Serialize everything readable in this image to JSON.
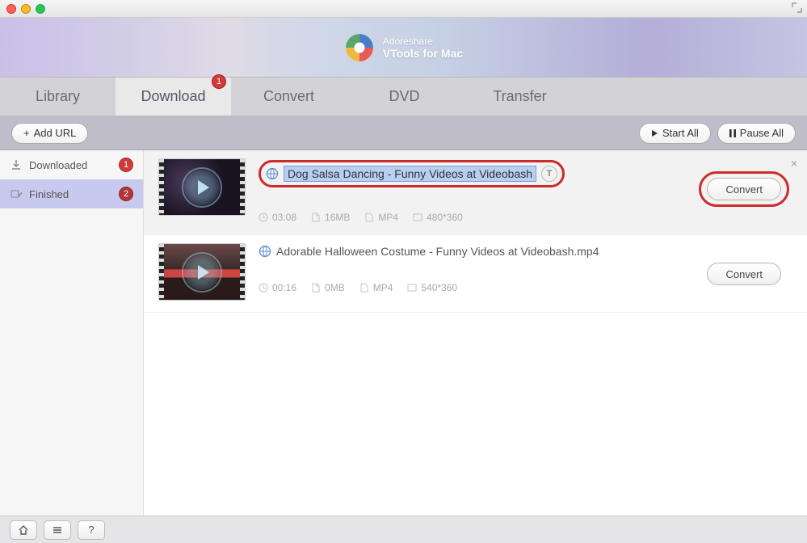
{
  "brand": "Adoreshare",
  "product": "VTools for Mac",
  "tabs": {
    "library": "Library",
    "download": "Download",
    "download_badge": "1",
    "convert": "Convert",
    "dvd": "DVD",
    "transfer": "Transfer"
  },
  "toolbar": {
    "add_url": "Add URL",
    "start_all": "Start All",
    "pause_all": "Pause All"
  },
  "sidebar": {
    "downloaded": {
      "label": "Downloaded",
      "badge": "1"
    },
    "finished": {
      "label": "Finished",
      "badge": "2"
    }
  },
  "videos": [
    {
      "title": "Dog Salsa Dancing - Funny Videos at Videobash",
      "duration": "03:08",
      "size": "16MB",
      "format": "MP4",
      "resolution": "480*360",
      "convert_label": "Convert",
      "highlighted": true
    },
    {
      "title": "Adorable Halloween Costume - Funny Videos at Videobash.mp4",
      "duration": "00:16",
      "size": "0MB",
      "format": "MP4",
      "resolution": "540*360",
      "convert_label": "Convert",
      "highlighted": false
    }
  ],
  "edit_symbol": "T"
}
